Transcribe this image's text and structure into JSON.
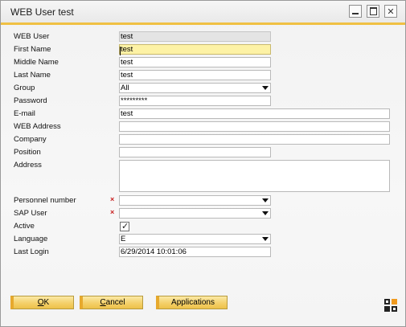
{
  "window": {
    "title": "WEB User test",
    "accent_color": "#f0c043"
  },
  "form": {
    "web_user": {
      "label": "WEB User",
      "value": "test"
    },
    "first_name": {
      "label": "First Name",
      "value": "test"
    },
    "middle_name": {
      "label": "Middle Name",
      "value": "test"
    },
    "last_name": {
      "label": "Last Name",
      "value": "test"
    },
    "group": {
      "label": "Group",
      "value": "All"
    },
    "password": {
      "label": "Password",
      "value": "*********"
    },
    "email": {
      "label": "E-mail",
      "value": "test"
    },
    "web_address": {
      "label": "WEB Address",
      "value": ""
    },
    "company": {
      "label": "Company",
      "value": ""
    },
    "position": {
      "label": "Position",
      "value": ""
    },
    "address": {
      "label": "Address",
      "value": ""
    },
    "personnel_number": {
      "label": "Personnel number",
      "value": "",
      "required_mark": "×"
    },
    "sap_user": {
      "label": "SAP User",
      "value": "",
      "required_mark": "×"
    },
    "active": {
      "label": "Active",
      "checked": true,
      "check_glyph": "✓"
    },
    "language": {
      "label": "Language",
      "value": "E"
    },
    "last_login": {
      "label": "Last Login",
      "value": "6/29/2014 10:01:06"
    }
  },
  "buttons": {
    "ok_prefix": "O",
    "ok_rest": "K",
    "cancel_prefix": "C",
    "cancel_rest": "ancel",
    "applications": "Applications"
  },
  "titlebar_icons": {
    "minimize": "minimize-icon",
    "maximize": "maximize-icon",
    "close": "close-icon"
  }
}
